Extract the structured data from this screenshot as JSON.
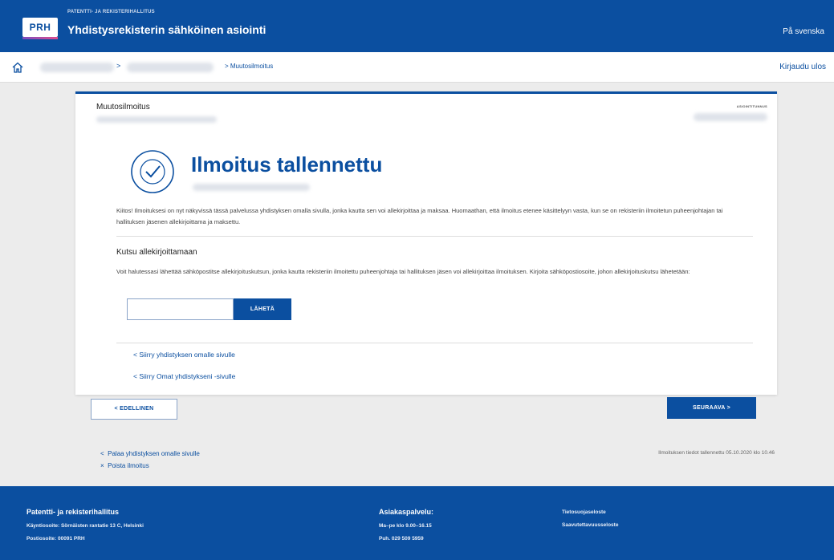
{
  "header": {
    "logo": "PRH",
    "org_small": "PATENTTI- JA REKISTERIHALLITUS",
    "app_title": "Yhdistysrekisterin sähköinen asiointi",
    "language_link": "På svenska"
  },
  "breadcrumb": {
    "separator": ">",
    "current": "> Muutosilmoitus",
    "logout": "Kirjaudu ulos"
  },
  "card": {
    "title": "Muutosilmoitus",
    "tag": "ASIOINTITUNNUS",
    "heading": "Ilmoitus tallennettu",
    "intro": "Kiitos! Ilmoituksesi on nyt näkyvissä tässä palvelussa yhdistyksen omalla sivulla, jonka kautta sen voi allekirjoittaa ja maksaa. Huomaathan, että ilmoitus etenee käsittelyyn vasta, kun se on rekisteriin ilmoitetun puheenjohtajan tai hallituksen jäsenen allekirjoittama ja maksettu.",
    "invite_heading": "Kutsu allekirjoittamaan",
    "invite_text": "Voit halutessasi lähettää sähköpostitse allekirjoituskutsun, jonka kautta rekisteriin ilmoitettu puheenjohtaja tai hallituksen jäsen voi allekirjoittaa ilmoituksen. Kirjoita sähköpostiosoite, johon allekirjoituskutsu lähetetään:",
    "email_value": "",
    "send_button": "LÄHETÄ",
    "link_association_page": "< Siirry yhdistyksen omalle sivulle",
    "link_my_associations": "< Siirry Omat yhdistykseni -sivulle"
  },
  "nav": {
    "previous": "< EDELLINEN",
    "next": "SEURAAVA >"
  },
  "below": {
    "return_link": "Palaa yhdistyksen omalle sivulle",
    "return_prefix": "<",
    "delete_link": "Poista ilmoitus",
    "delete_prefix": "×",
    "saved_info": "Ilmoituksen tiedot tallennettu 05.10.2020 klo 10.46"
  },
  "footer": {
    "org_name": "Patentti- ja rekisterihallitus",
    "visit_address": "Käyntiosoite: Sörnäisten rantatie 13 C, Helsinki",
    "postal_address": "Postiosoite: 00091 PRH",
    "service_title": "Asiakaspalvelu:",
    "service_hours": "Ma–pe klo 9.00–16.15",
    "service_phone": "Puh. 029 509 5959",
    "privacy_link": "Tietosuojaseloste",
    "accessibility_link": "Saavutettavuusseloste"
  },
  "colors": {
    "brand_blue": "#0b4fa0",
    "page_background": "#ececec"
  },
  "icons": {
    "home": "home-icon",
    "success": "check-circle-icon"
  }
}
